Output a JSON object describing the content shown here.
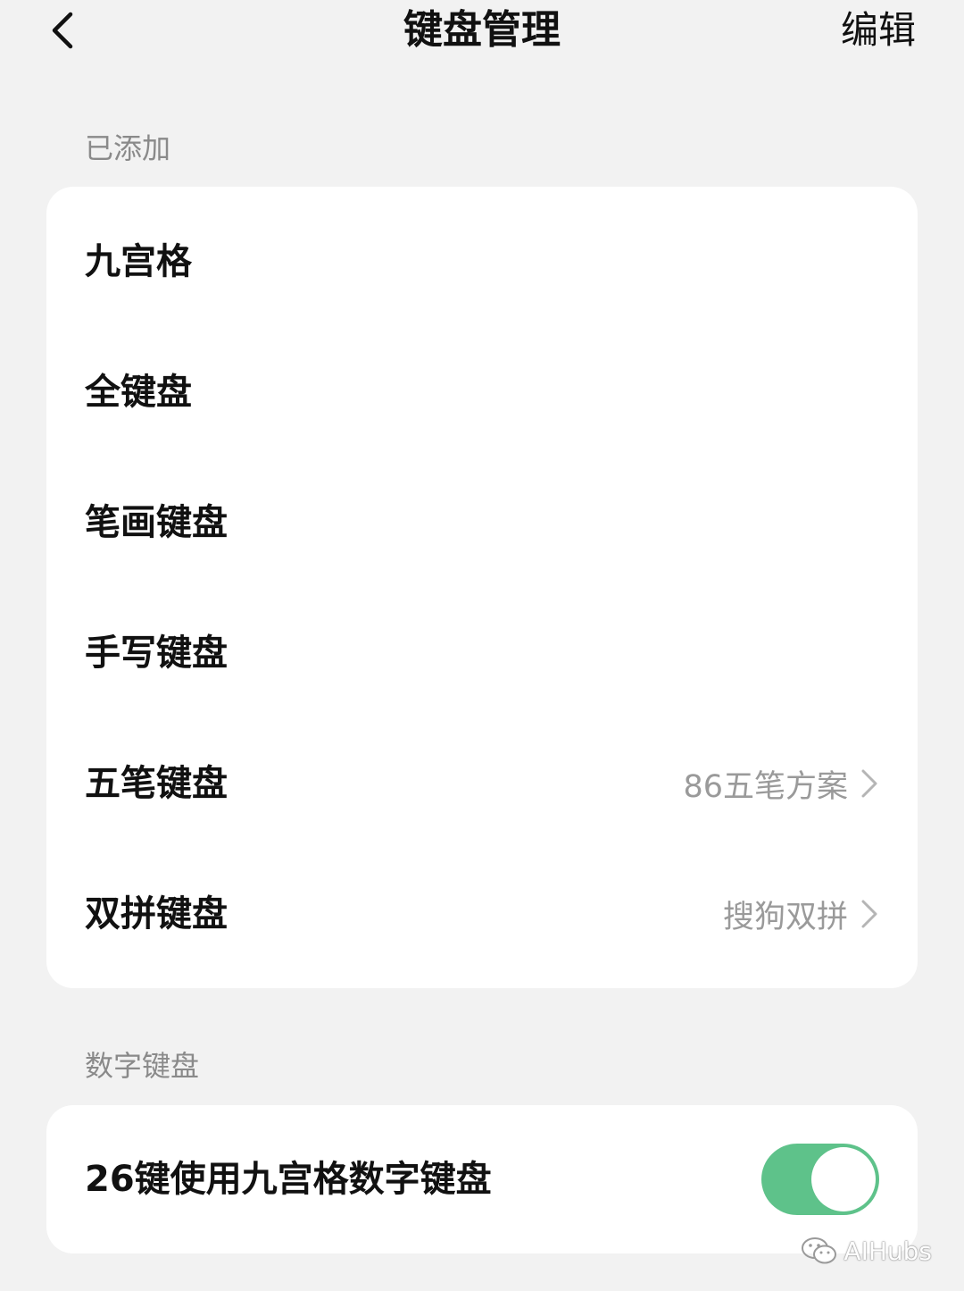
{
  "header": {
    "title": "键盘管理",
    "edit_label": "编辑"
  },
  "sections": {
    "added_label": "已添加",
    "numeric_label": "数字键盘"
  },
  "added_keyboards": [
    {
      "label": "九宫格",
      "value": ""
    },
    {
      "label": "全键盘",
      "value": ""
    },
    {
      "label": "笔画键盘",
      "value": ""
    },
    {
      "label": "手写键盘",
      "value": ""
    },
    {
      "label": "五笔键盘",
      "value": "86五笔方案"
    },
    {
      "label": "双拼键盘",
      "value": "搜狗双拼"
    }
  ],
  "numeric": {
    "toggle_label": "26键使用九宫格数字键盘",
    "toggle_on": true
  },
  "watermark": {
    "text": "AIHubs"
  },
  "colors": {
    "background": "#f2f2f2",
    "card": "#ffffff",
    "accent_toggle": "#5ec28a",
    "secondary_text": "#8a8a8a"
  }
}
